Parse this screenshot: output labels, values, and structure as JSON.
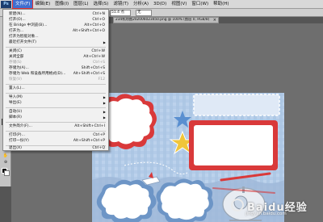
{
  "menubar": {
    "logo": "Ps",
    "items": [
      "文件(F)",
      "编辑(E)",
      "图像(I)",
      "图层(L)",
      "选择(S)",
      "滤镜(T)",
      "分析(A)",
      "3D(D)",
      "视图(V)",
      "窗口(W)",
      "帮助(H)"
    ]
  },
  "options": {
    "size_value": "51.4 点",
    "mode_value": "无"
  },
  "document": {
    "tab_title": "234机场图202006023450.png @ 100% (图层 0, RGB/8)",
    "close_glyph": "×"
  },
  "file_menu": {
    "items": [
      {
        "label": "新建(N)...",
        "shortcut": "Ctrl+N"
      },
      {
        "label": "打开(O)...",
        "shortcut": "Ctrl+O"
      },
      {
        "label": "在 Bridge 中浏览(B)...",
        "shortcut": "Alt+Ctrl+O"
      },
      {
        "label": "打开为...",
        "shortcut": "Alt+Shift+Ctrl+O"
      },
      {
        "label": "打开为智能对象...",
        "shortcut": ""
      },
      {
        "label": "最近打开文件(T)",
        "shortcut": ""
      },
      {
        "label": "关闭(C)",
        "shortcut": "Ctrl+W"
      },
      {
        "label": "关闭全部",
        "shortcut": "Alt+Ctrl+W"
      },
      {
        "label": "存储(S)",
        "shortcut": "Ctrl+S"
      },
      {
        "label": "存储为(A)...",
        "shortcut": "Shift+Ctrl+S"
      },
      {
        "label": "存储为 Web 和设备所用格式(D)...",
        "shortcut": "Alt+Shift+Ctrl+S"
      },
      {
        "label": "恢复(V)",
        "shortcut": "F12"
      },
      {
        "label": "置入(L)...",
        "shortcut": ""
      },
      {
        "label": "导入(M)",
        "shortcut": ""
      },
      {
        "label": "导出(E)",
        "shortcut": ""
      },
      {
        "label": "自动(U)",
        "shortcut": ""
      },
      {
        "label": "脚本(R)",
        "shortcut": ""
      },
      {
        "label": "文件简介(F)...",
        "shortcut": "Alt+Shift+Ctrl+I"
      },
      {
        "label": "打印(P)...",
        "shortcut": "Ctrl+P"
      },
      {
        "label": "打印一份(Y)",
        "shortcut": "Alt+Shift+Ctrl+P"
      },
      {
        "label": "退出(X)",
        "shortcut": "Ctrl+Q"
      }
    ],
    "submenu_arrow": "▶"
  },
  "toolbox": {
    "tools": [
      "move-icon",
      "marquee-icon",
      "lasso-icon",
      "magic-wand-icon",
      "crop-icon",
      "eyedropper-icon",
      "healing-icon",
      "brush-icon",
      "clone-stamp-icon",
      "history-brush-icon",
      "eraser-icon",
      "gradient-icon",
      "blur-icon",
      "dodge-icon",
      "pen-icon",
      "type-icon",
      "path-select-icon",
      "shape-icon",
      "3d-rotate-icon",
      "3d-orbit-icon",
      "hand-icon",
      "zoom-icon"
    ],
    "glyphs": [
      "✥",
      "⬚",
      "ʘ",
      "✶",
      "⌗",
      "⚲",
      "✚",
      "✎",
      "✿",
      "↺",
      "◧",
      "▦",
      "◆",
      "◑",
      "✒",
      "T",
      "➤",
      "■",
      "⟳",
      "◎",
      "✋",
      "⊕"
    ],
    "type_tool_label": "T"
  },
  "watermark": {
    "brand": "Baidu经验",
    "url": "jingyan.baidu.com"
  },
  "colors": {
    "menu_highlight": "#3f6fd0",
    "artwork_bg": "#b7cde8",
    "frame_red": "#d9393a"
  }
}
